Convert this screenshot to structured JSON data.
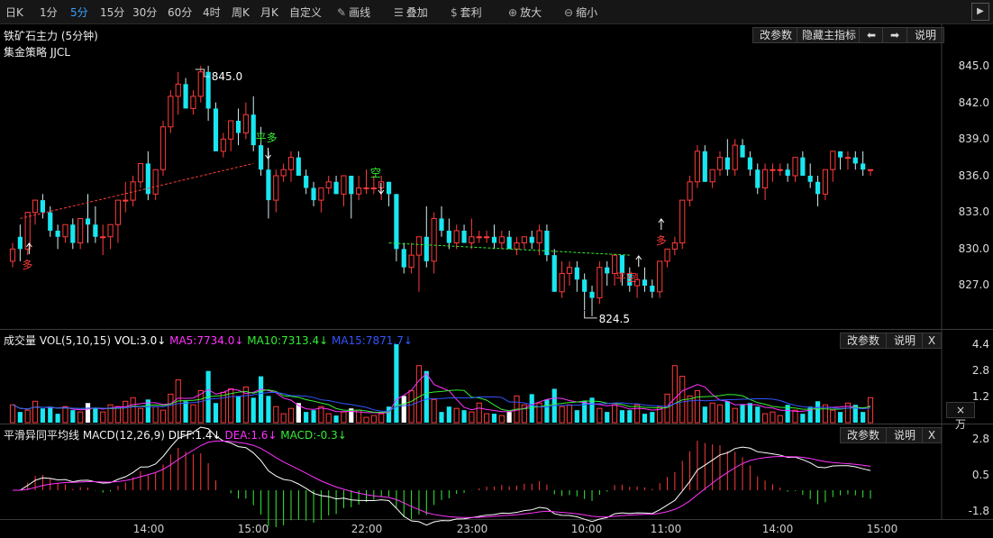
{
  "toolbar": {
    "periods": [
      {
        "label": "日K",
        "active": false
      },
      {
        "label": "1分",
        "active": false
      },
      {
        "label": "5分",
        "active": true
      },
      {
        "label": "15分",
        "active": false
      },
      {
        "label": "30分",
        "active": false
      },
      {
        "label": "60分",
        "active": false
      },
      {
        "label": "4时",
        "active": false
      },
      {
        "label": "周K",
        "active": false
      },
      {
        "label": "月K",
        "active": false
      },
      {
        "label": "自定义",
        "active": false
      }
    ],
    "tools": [
      {
        "icon": "pencil-icon",
        "glyph": "✎",
        "label": "画线"
      },
      {
        "icon": "layers-icon",
        "glyph": "☰",
        "label": "叠加"
      },
      {
        "icon": "moneybag-icon",
        "glyph": "$",
        "label": "套利"
      },
      {
        "icon": "zoom-in-icon",
        "glyph": "⊕",
        "label": "放大"
      },
      {
        "icon": "zoom-out-icon",
        "glyph": "⊖",
        "label": "缩小"
      }
    ]
  },
  "main": {
    "instrument": "铁矿石主力 (5分钟)",
    "strategy": "集金策略 JJCL",
    "buttons": {
      "params": "改参数",
      "hide": "隐藏主指标",
      "prev": "⬅",
      "next": "➡",
      "help": "说明"
    },
    "y_ticks": [
      "845.0",
      "842.0",
      "839.0",
      "836.0",
      "833.0",
      "830.0",
      "827.0"
    ],
    "annotations": {
      "high": "845.0",
      "low": "824.5",
      "long1": "多",
      "close_long": "平多",
      "short1": "空",
      "close_short": "平空",
      "long2": "多"
    }
  },
  "volume": {
    "title": "成交量 VOL(5,10,15)",
    "vol": "VOL:3.0↓",
    "ma5": "MA5:7734.0↓",
    "ma10": "MA10:7313.4↓",
    "ma15": "MA15:7871.7↓",
    "buttons": {
      "params": "改参数",
      "help": "说明",
      "close": "X"
    },
    "y_ticks": [
      "4.4",
      "2.8",
      "1.2"
    ],
    "unit": "×万"
  },
  "macd": {
    "title": "平滑异同平均线 MACD(12,26,9)",
    "diff": "DIFF:1.4↓",
    "dea": "DEA:1.6↓",
    "macd": "MACD:-0.3↓",
    "buttons": {
      "params": "改参数",
      "help": "说明",
      "close": "X"
    },
    "y_ticks": [
      "2.8",
      "0.5",
      "-1.8"
    ]
  },
  "x_axis": [
    "14:00",
    "15:00",
    "22:00",
    "23:00",
    "10:00",
    "11:00",
    "14:00",
    "15:00"
  ],
  "colors": {
    "up": "#ff3b3b",
    "down": "#19e6f0",
    "ma5": "#ff33ff",
    "ma10": "#33ee33",
    "ma15": "#3355ff",
    "diff": "#ffffff",
    "dea": "#ff33ff",
    "macd_pos": "#ff3b3b",
    "macd_neg": "#33ee33"
  },
  "chart_data": {
    "type": "candlestick",
    "ylim": [
      824.5,
      845.0
    ],
    "ohlc": [
      [
        829,
        830.5,
        828.5,
        830
      ],
      [
        831,
        832,
        829,
        830
      ],
      [
        830,
        833,
        829.5,
        833
      ],
      [
        833,
        834,
        832,
        834
      ],
      [
        834,
        834.5,
        832.5,
        833
      ],
      [
        833,
        833.5,
        831,
        831.5
      ],
      [
        831.5,
        832,
        830,
        831
      ],
      [
        831,
        832,
        830.5,
        832
      ],
      [
        832,
        832.5,
        830,
        830.5
      ],
      [
        830.5,
        832.5,
        830,
        832.5
      ],
      [
        832.5,
        834.5,
        830.5,
        832
      ],
      [
        832,
        833.5,
        830.5,
        831
      ],
      [
        831,
        832,
        829.5,
        831
      ],
      [
        831,
        832,
        830,
        832
      ],
      [
        832,
        834,
        830.5,
        834
      ],
      [
        834,
        835.5,
        833,
        834
      ],
      [
        834,
        836,
        833.5,
        835.5
      ],
      [
        835.5,
        837,
        835,
        837
      ],
      [
        837,
        838,
        834,
        834.5
      ],
      [
        834.5,
        836.5,
        834,
        836.5
      ],
      [
        836.5,
        840.5,
        836,
        840
      ],
      [
        840,
        843,
        839.5,
        842.5
      ],
      [
        842.5,
        844.5,
        841,
        843.5
      ],
      [
        843.5,
        844,
        842,
        841.5
      ],
      [
        841.5,
        843,
        841,
        842.5
      ],
      [
        842.5,
        845,
        842,
        844.5
      ],
      [
        844.5,
        845,
        840.5,
        841.5
      ],
      [
        841.5,
        842,
        838,
        838
      ],
      [
        838,
        839.5,
        837.5,
        839
      ],
      [
        839,
        840.5,
        838,
        840.5
      ],
      [
        840.5,
        841.5,
        838.5,
        839.5
      ],
      [
        839.5,
        842,
        839,
        841
      ],
      [
        841,
        842.5,
        838,
        838.5
      ],
      [
        838.5,
        840,
        836,
        836.5
      ],
      [
        836.5,
        838,
        832.5,
        834
      ],
      [
        834,
        836.5,
        833,
        836
      ],
      [
        836,
        837,
        835.5,
        836.5
      ],
      [
        836.5,
        838,
        835.5,
        837.5
      ],
      [
        837.5,
        838,
        836,
        836
      ],
      [
        836,
        836.5,
        834.5,
        835
      ],
      [
        835,
        835.5,
        833.5,
        834
      ],
      [
        834,
        835,
        833,
        835
      ],
      [
        835,
        836,
        834.5,
        835.5
      ],
      [
        835.5,
        836,
        834.5,
        834.5
      ],
      [
        834.5,
        836,
        833.5,
        836
      ],
      [
        836,
        836,
        832.5,
        834.5
      ],
      [
        834.5,
        836,
        834,
        835
      ],
      [
        835,
        836.5,
        834.5,
        835
      ],
      [
        835,
        836,
        834.5,
        835
      ],
      [
        835,
        836,
        834,
        835.5
      ],
      [
        835.5,
        835.5,
        833.5,
        834.5
      ],
      [
        834.5,
        834.5,
        829,
        830
      ],
      [
        830,
        830.5,
        828,
        828.5
      ],
      [
        828.5,
        830.5,
        828,
        829.5
      ],
      [
        829.5,
        831,
        826.5,
        831
      ],
      [
        831,
        833.5,
        828.5,
        829
      ],
      [
        829,
        833,
        828,
        832.5
      ],
      [
        832.5,
        833.5,
        831,
        831.5
      ],
      [
        831.5,
        832.5,
        830,
        830.5
      ],
      [
        830.5,
        832,
        830,
        831.5
      ],
      [
        831.5,
        832,
        830.5,
        830.5
      ],
      [
        830.5,
        832.5,
        830,
        831
      ],
      [
        831,
        831.5,
        830.5,
        831
      ],
      [
        831,
        831.5,
        830.5,
        831
      ],
      [
        831,
        832,
        830,
        830.5
      ],
      [
        830.5,
        831.5,
        830,
        831
      ],
      [
        831,
        831.5,
        830,
        830
      ],
      [
        830,
        831,
        829.5,
        830.5
      ],
      [
        830.5,
        831,
        830,
        831
      ],
      [
        831,
        831.5,
        830,
        830.5
      ],
      [
        830.5,
        832,
        829.5,
        831.5
      ],
      [
        831.5,
        832,
        829,
        829.5
      ],
      [
        829.5,
        830,
        826.5,
        826.5
      ],
      [
        826.5,
        829,
        826,
        828
      ],
      [
        828,
        829,
        827,
        828.5
      ],
      [
        828.5,
        829,
        826.5,
        827.5
      ],
      [
        827.5,
        828,
        825,
        826.5
      ],
      [
        826.5,
        827,
        824.5,
        826
      ],
      [
        826,
        829,
        825.5,
        828.5
      ],
      [
        828.5,
        829,
        827,
        828
      ],
      [
        828,
        829.5,
        827,
        829.5
      ],
      [
        829.5,
        829.5,
        827,
        828
      ],
      [
        828,
        828.5,
        826.5,
        827
      ],
      [
        827,
        828,
        826,
        827.5
      ],
      [
        827.5,
        828.5,
        826.5,
        827
      ],
      [
        827,
        827.5,
        826,
        826.5
      ],
      [
        826.5,
        829,
        826,
        829
      ],
      [
        829,
        830,
        828.5,
        830
      ],
      [
        830,
        831,
        829.5,
        830.5
      ],
      [
        830.5,
        834,
        830,
        834
      ],
      [
        834,
        836,
        833.5,
        835.5
      ],
      [
        835.5,
        838.5,
        835,
        838
      ],
      [
        838,
        838.5,
        835.5,
        835.5
      ],
      [
        835.5,
        836.5,
        835,
        836.5
      ],
      [
        836.5,
        838,
        836,
        837.5
      ],
      [
        837.5,
        839,
        836,
        836.5
      ],
      [
        836.5,
        839,
        836,
        838.5
      ],
      [
        838.5,
        839,
        837.5,
        837.5
      ],
      [
        837.5,
        838,
        836,
        836.5
      ],
      [
        836.5,
        837,
        834.5,
        835
      ],
      [
        835,
        837,
        834,
        836.5
      ],
      [
        836.5,
        837,
        835.5,
        836.5
      ],
      [
        836.5,
        837,
        836,
        836.5
      ],
      [
        836.5,
        837,
        835.5,
        836
      ],
      [
        836,
        837.5,
        835.5,
        837.5
      ],
      [
        837.5,
        838,
        836,
        836
      ],
      [
        836,
        837,
        835,
        835.5
      ],
      [
        835.5,
        836,
        833.5,
        834.5
      ],
      [
        834.5,
        836.5,
        834,
        836.5
      ],
      [
        836.5,
        838,
        835.5,
        838
      ],
      [
        838,
        838,
        836.5,
        837.5
      ],
      [
        837.5,
        838,
        836.5,
        837.5
      ],
      [
        837.5,
        838,
        836.5,
        837
      ],
      [
        837,
        838,
        836,
        836.5
      ],
      [
        836.5,
        836.5,
        836,
        836.5
      ]
    ],
    "volume": [
      1.0,
      0.6,
      0.7,
      1.2,
      0.8,
      0.9,
      0.5,
      0.9,
      0.7,
      0.6,
      1.1,
      0.8,
      0.6,
      1.0,
      0.9,
      1.2,
      1.4,
      0.8,
      1.3,
      0.9,
      0.7,
      1.6,
      2.4,
      1.2,
      1.0,
      1.8,
      2.9,
      1.1,
      1.7,
      1.9,
      1.5,
      2.0,
      1.4,
      2.6,
      1.5,
      0.9,
      0.5,
      0.8,
      1.1,
      0.6,
      0.7,
      0.9,
      0.5,
      0.4,
      0.6,
      0.8,
      0.7,
      0.3,
      0.4,
      0.5,
      0.9,
      4.4,
      1.5,
      1.8,
      3.2,
      2.9,
      1.3,
      0.6,
      0.9,
      0.8,
      0.7,
      0.6,
      1.1,
      0.5,
      0.5,
      0.4,
      0.6,
      1.5,
      1.0,
      1.6,
      1.1,
      1.3,
      1.9,
      0.9,
      1.0,
      0.7,
      1.2,
      1.4,
      0.8,
      0.6,
      1.0,
      0.7,
      0.7,
      1.0,
      0.5,
      0.6,
      0.9,
      1.6,
      3.2,
      2.6,
      1.5,
      1.8,
      0.9,
      1.1,
      1.0,
      1.2,
      0.8,
      1.0,
      1.1,
      0.9,
      0.5,
      0.6,
      0.4,
      1.0,
      0.7,
      0.5,
      0.9,
      1.2,
      1.0,
      0.7,
      0.6,
      1.1,
      1.0,
      0.6,
      1.4
    ],
    "xlabels": [
      "14:00",
      "15:00",
      "22:00",
      "23:00",
      "10:00",
      "11:00",
      "14:00",
      "15:00"
    ],
    "signals": [
      {
        "label": "多",
        "type": "buy"
      },
      {
        "label": "平多",
        "type": "close_long"
      },
      {
        "label": "空",
        "type": "sell"
      },
      {
        "label": "平空",
        "type": "close_short"
      },
      {
        "label": "多",
        "type": "buy"
      }
    ]
  }
}
